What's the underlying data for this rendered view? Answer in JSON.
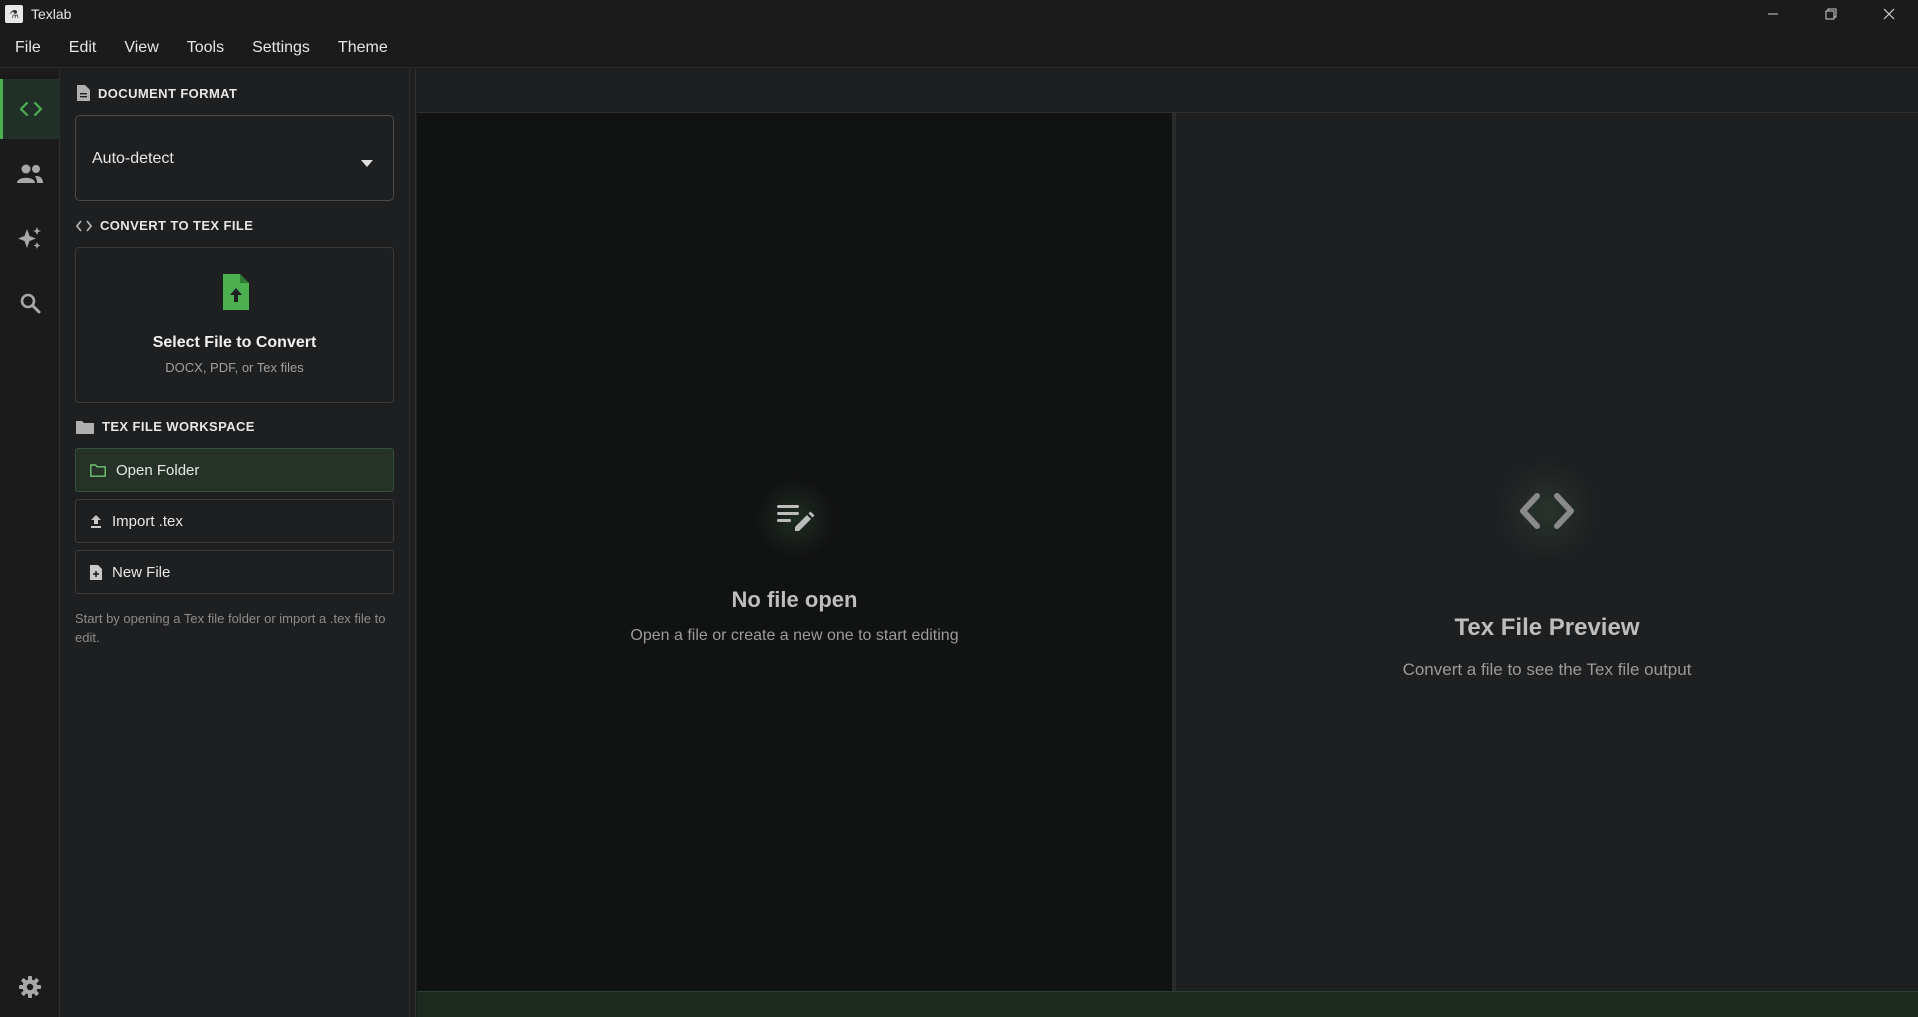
{
  "window": {
    "title": "Texlab",
    "app_icon_glyph": "⚗"
  },
  "menu": {
    "items": [
      "File",
      "Edit",
      "View",
      "Tools",
      "Settings",
      "Theme"
    ]
  },
  "activity_bar": {
    "items": [
      {
        "icon": "code-icon",
        "active": true
      },
      {
        "icon": "users-icon",
        "active": false
      },
      {
        "icon": "sparkles-icon",
        "active": false
      },
      {
        "icon": "search-icon",
        "active": false
      }
    ],
    "bottom_icon": "gear-icon"
  },
  "sidebar": {
    "document_format": {
      "heading": "DOCUMENT FORMAT",
      "selected": "Auto-detect"
    },
    "convert": {
      "heading": "CONVERT TO TEX FILE",
      "dropzone_title": "Select File to Convert",
      "dropzone_subtitle": "DOCX, PDF, or Tex files"
    },
    "workspace": {
      "heading": "TEX FILE WORKSPACE",
      "open_folder": "Open Folder",
      "import_tex": "Import .tex",
      "new_file": "New File",
      "hint": "Start by opening a Tex file folder or import a .tex file to edit."
    }
  },
  "editor": {
    "empty_title": "No file open",
    "empty_subtitle": "Open a file or create a new one to start editing"
  },
  "preview": {
    "empty_title": "Tex File Preview",
    "empty_subtitle": "Convert a file to see the Tex file output"
  },
  "colors": {
    "accent": "#4caf50",
    "background": "#1e1f21",
    "editor_background": "#111212"
  }
}
